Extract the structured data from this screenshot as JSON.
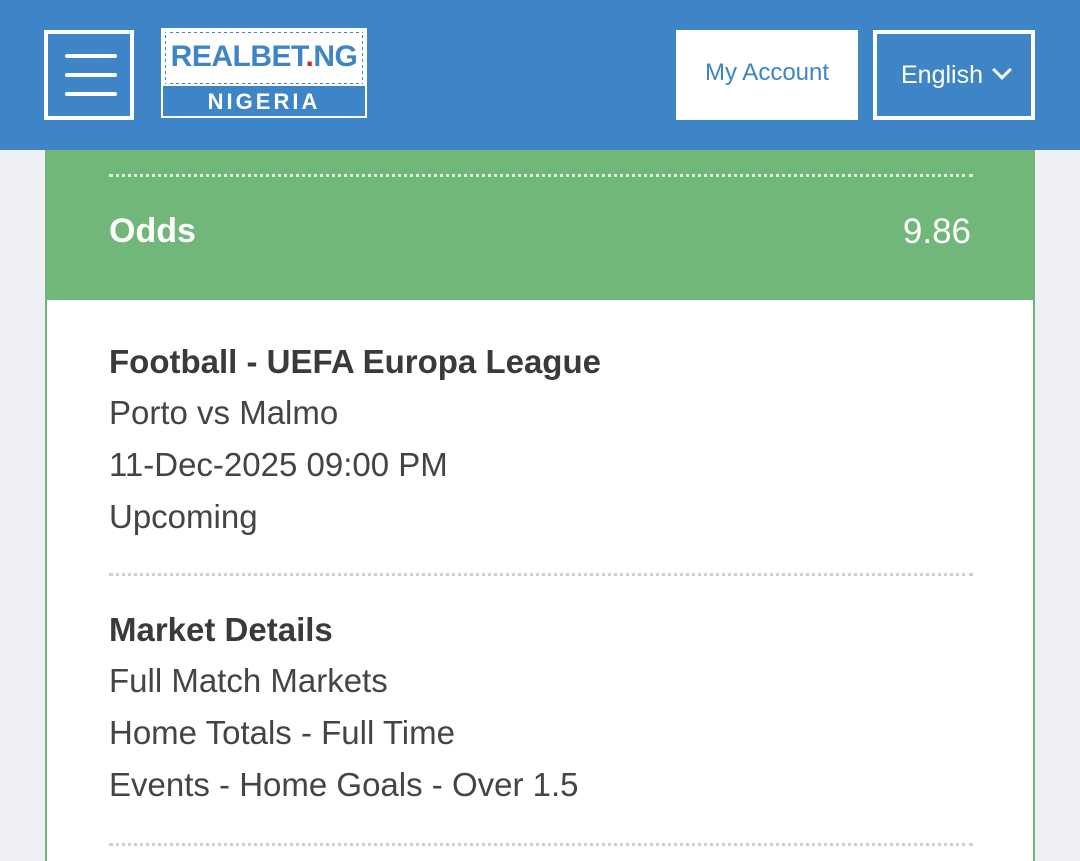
{
  "header": {
    "logo_brand_main": "REALBET",
    "logo_brand_dot": ".",
    "logo_brand_tld": "NG",
    "logo_country": "NIGERIA",
    "account_label": "My Account",
    "language_label": "English",
    "colors": {
      "header_bg": "#3d85c6",
      "button_bg": "#ffffff",
      "logo_dot": "#cc2a2a"
    }
  },
  "odds": {
    "label": "Odds",
    "value": "9.86",
    "color": "#72b77a"
  },
  "event": {
    "title": "Football - UEFA Europa League",
    "match": "Porto vs Malmo",
    "datetime": "11-Dec-2025 09:00 PM",
    "status": "Upcoming"
  },
  "market": {
    "title": "Market Details",
    "lines": [
      "Full Match Markets",
      "Home Totals - Full Time",
      "Events - Home Goals - Over 1.5"
    ]
  },
  "icons": {
    "menu": "hamburger-menu-icon",
    "language": "chevron-down-icon"
  }
}
